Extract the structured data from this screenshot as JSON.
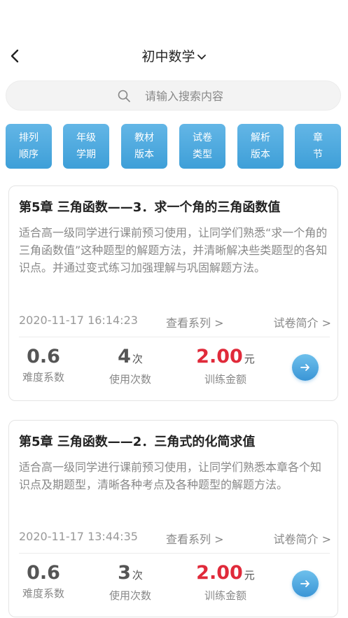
{
  "header": {
    "title": "初中数学"
  },
  "search": {
    "placeholder": "请输入搜索内容"
  },
  "filters": [
    {
      "line1": "排列",
      "line2": "顺序"
    },
    {
      "line1": "年级",
      "line2": "学期"
    },
    {
      "line1": "教材",
      "line2": "版本"
    },
    {
      "line1": "试卷",
      "line2": "类型"
    },
    {
      "line1": "解析",
      "line2": "版本"
    },
    {
      "line1": "章",
      "line2": "节"
    }
  ],
  "cards": [
    {
      "title": "第5章  三角函数——3．求一个角的三角函数值",
      "desc": "适合高一级同学进行课前预习使用，让同学们熟悉“求一个角的三角函数值”这种题型的解题方法，并清晰解决些类题型的各知识点。并通过变式练习加强理解与巩固解题方法。",
      "date": "2020-11-17 16:14:23",
      "series_label": "查看系列 >",
      "intro_label": "试卷简介 >",
      "difficulty": "0.6",
      "difficulty_label": "难度系数",
      "uses": "4",
      "uses_unit": "次",
      "uses_label": "使用次数",
      "amount": "2.00",
      "amount_unit": "元",
      "amount_label": "训练金额"
    },
    {
      "title": "第5章  三角函数——2．三角式的化简求值",
      "desc": "适合高一级同学进行课前预习使用，让同学们熟悉本章各个知识点及期题型，清晰各种考点及各种题型的解题方法。",
      "date": "2020-11-17 13:44:35",
      "series_label": "查看系列 >",
      "intro_label": "试卷简介 >",
      "difficulty": "0.6",
      "difficulty_label": "难度系数",
      "uses": "3",
      "uses_unit": "次",
      "uses_label": "使用次数",
      "amount": "2.00",
      "amount_unit": "元",
      "amount_label": "训练金额"
    }
  ],
  "icons": {
    "back": "chevron-left-icon",
    "title_dropdown": "chevron-down-icon",
    "search": "search-icon",
    "go": "arrow-right-icon"
  },
  "colors": {
    "accent": "#4aa6dd",
    "price": "#e02a3a"
  }
}
